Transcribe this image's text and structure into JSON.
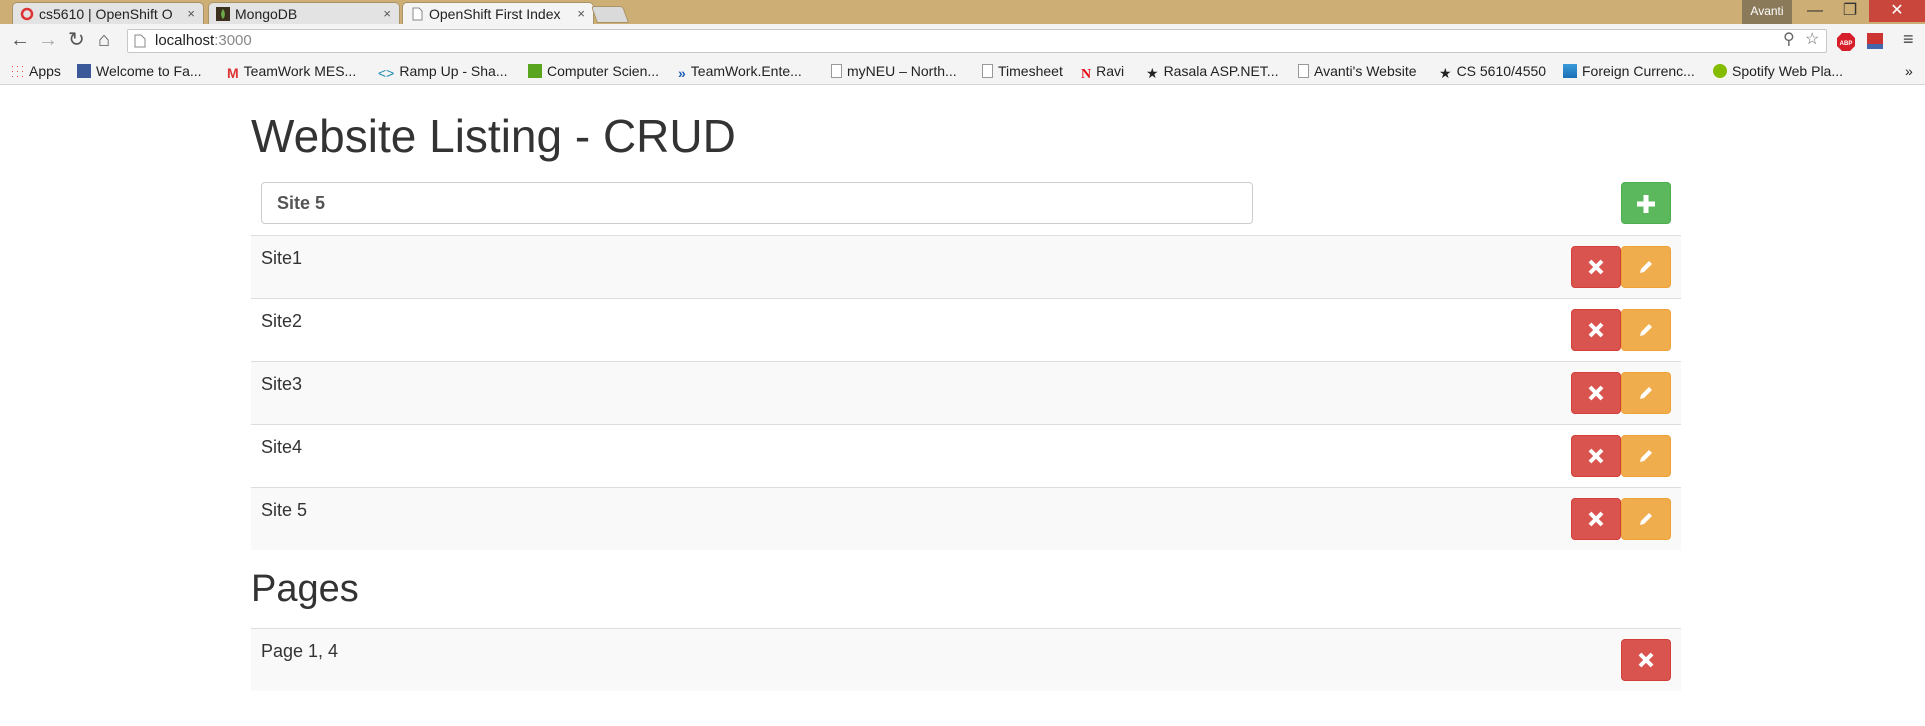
{
  "browser": {
    "tabs": [
      {
        "title": "cs5610 | OpenShift O",
        "close": "×"
      },
      {
        "title": "MongoDB",
        "close": "×"
      },
      {
        "title": "OpenShift First Index",
        "close": "×"
      }
    ],
    "profile_name": "Avanti",
    "window_controls": {
      "minimize": "—",
      "maximize": "❐",
      "close": "✕"
    },
    "url_host": "localhost",
    "url_port": ":3000",
    "bookmarks": [
      {
        "label": "Apps",
        "icon": "apps-grid-icon"
      },
      {
        "label": "Welcome to Fa...",
        "icon": "facebook-icon"
      },
      {
        "label": "TeamWork MES...",
        "icon": "gmail-icon"
      },
      {
        "label": "Ramp Up - Sha...",
        "icon": "code-icon"
      },
      {
        "label": "Computer Scien...",
        "icon": "green-doc-icon"
      },
      {
        "label": "TeamWork.Ente...",
        "icon": "chevrons-icon"
      },
      {
        "label": "myNEU – North...",
        "icon": "page-icon"
      },
      {
        "label": "Timesheet",
        "icon": "page-icon"
      },
      {
        "label": "Ravi",
        "icon": "netflix-icon"
      },
      {
        "label": "Rasala ASP.NET...",
        "icon": "star-icon"
      },
      {
        "label": "Avanti's Website",
        "icon": "page-icon"
      },
      {
        "label": "CS 5610/4550",
        "icon": "star-icon"
      },
      {
        "label": "Foreign Currenc...",
        "icon": "blue-square-icon"
      },
      {
        "label": "Spotify Web Pla...",
        "icon": "spotify-icon"
      }
    ],
    "more_bookmarks": "»"
  },
  "page": {
    "title": "Website Listing - CRUD",
    "site_input_value": "Site 5",
    "sites": [
      "Site1",
      "Site2",
      "Site3",
      "Site4",
      "Site 5"
    ],
    "pages_title": "Pages",
    "pages": [
      "Page 1, 4"
    ]
  },
  "colors": {
    "add_button": "#5cb85c",
    "delete_button": "#d9534f",
    "edit_button": "#f0ad4e"
  }
}
